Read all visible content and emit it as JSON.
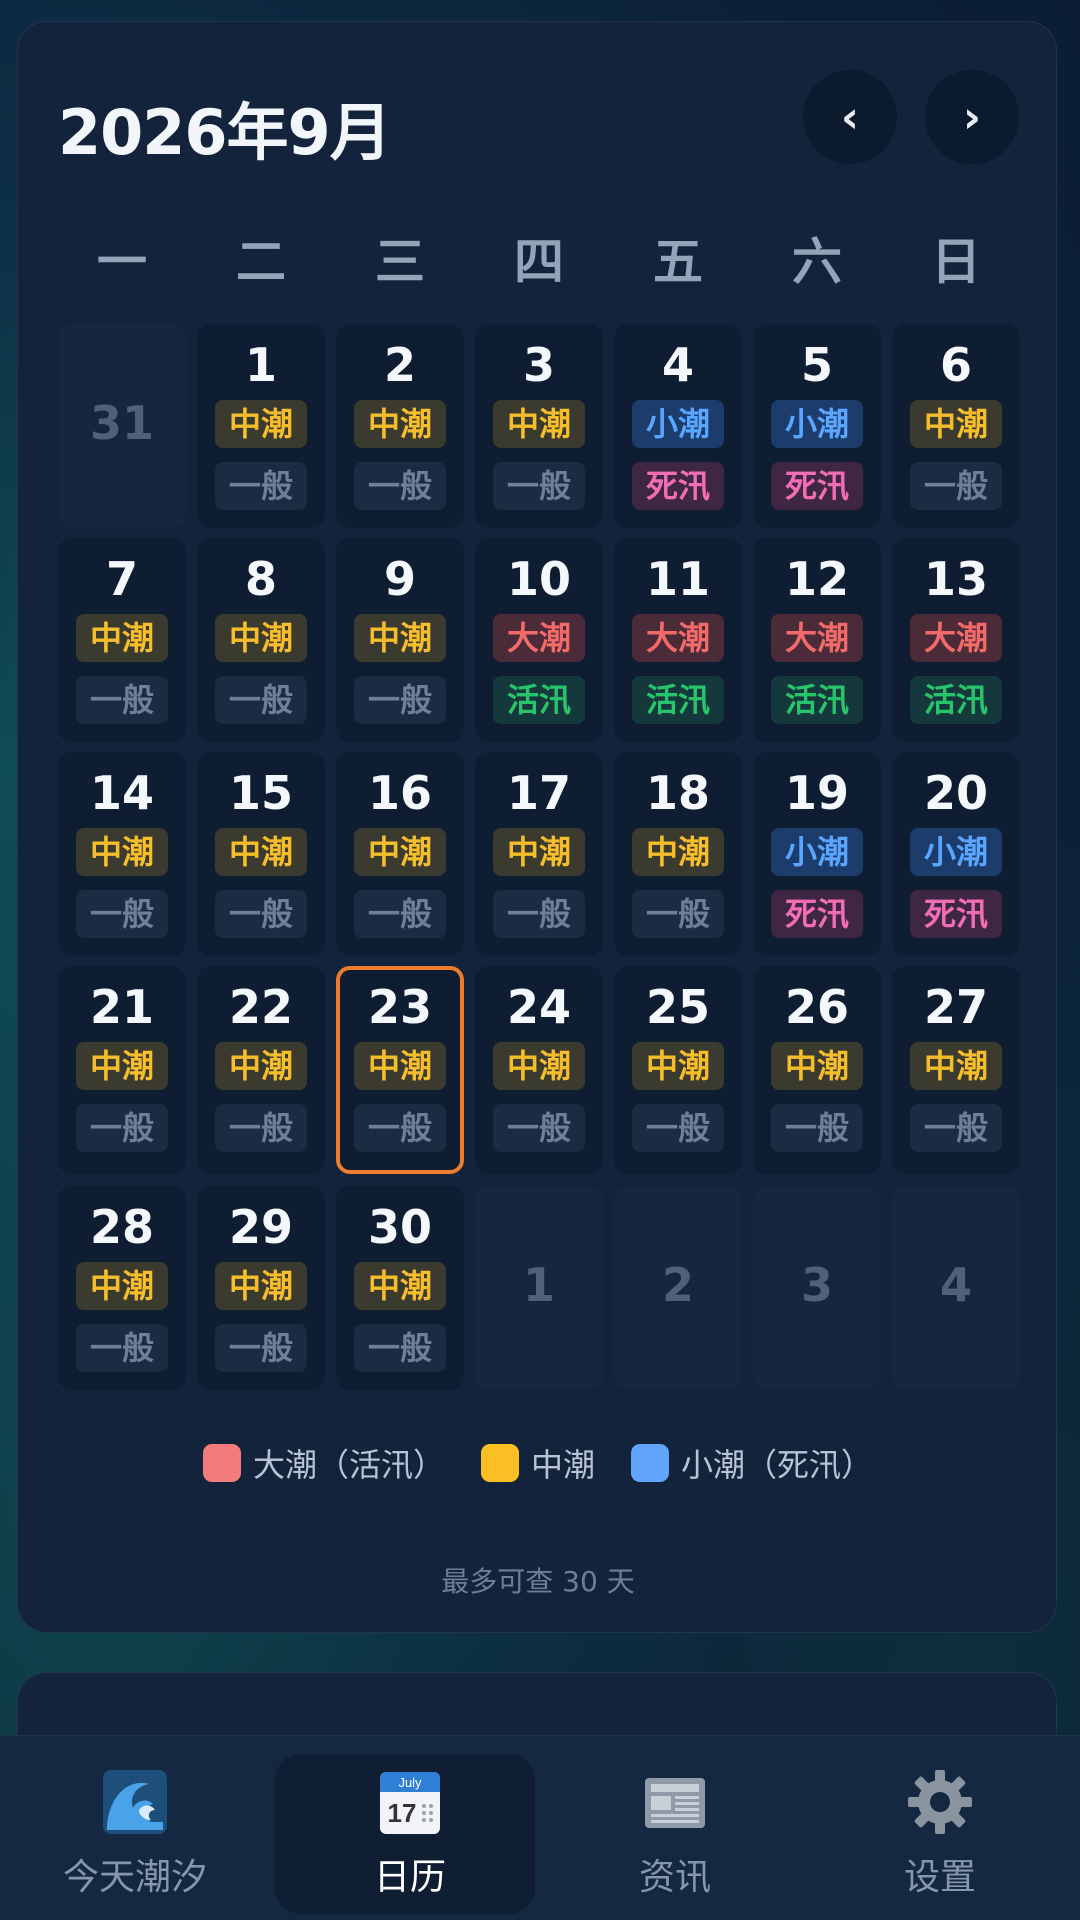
{
  "header": {
    "title": "2026年9月",
    "prev_icon": "‹",
    "next_icon": "›"
  },
  "weekdays": [
    "一",
    "二",
    "三",
    "四",
    "五",
    "六",
    "日"
  ],
  "weeks": [
    [
      {
        "day": "31",
        "outside": true
      },
      {
        "day": "1",
        "tide": "中潮",
        "tide_type": "mid",
        "fish": "一般",
        "fish_type": "normal"
      },
      {
        "day": "2",
        "tide": "中潮",
        "tide_type": "mid",
        "fish": "一般",
        "fish_type": "normal"
      },
      {
        "day": "3",
        "tide": "中潮",
        "tide_type": "mid",
        "fish": "一般",
        "fish_type": "normal"
      },
      {
        "day": "4",
        "tide": "小潮",
        "tide_type": "small",
        "fish": "死汛",
        "fish_type": "dead"
      },
      {
        "day": "5",
        "tide": "小潮",
        "tide_type": "small",
        "fish": "死汛",
        "fish_type": "dead"
      },
      {
        "day": "6",
        "tide": "中潮",
        "tide_type": "mid",
        "fish": "一般",
        "fish_type": "normal"
      }
    ],
    [
      {
        "day": "7",
        "tide": "中潮",
        "tide_type": "mid",
        "fish": "一般",
        "fish_type": "normal"
      },
      {
        "day": "8",
        "tide": "中潮",
        "tide_type": "mid",
        "fish": "一般",
        "fish_type": "normal"
      },
      {
        "day": "9",
        "tide": "中潮",
        "tide_type": "mid",
        "fish": "一般",
        "fish_type": "normal"
      },
      {
        "day": "10",
        "tide": "大潮",
        "tide_type": "big",
        "fish": "活汛",
        "fish_type": "live"
      },
      {
        "day": "11",
        "tide": "大潮",
        "tide_type": "big",
        "fish": "活汛",
        "fish_type": "live"
      },
      {
        "day": "12",
        "tide": "大潮",
        "tide_type": "big",
        "fish": "活汛",
        "fish_type": "live"
      },
      {
        "day": "13",
        "tide": "大潮",
        "tide_type": "big",
        "fish": "活汛",
        "fish_type": "live"
      }
    ],
    [
      {
        "day": "14",
        "tide": "中潮",
        "tide_type": "mid",
        "fish": "一般",
        "fish_type": "normal"
      },
      {
        "day": "15",
        "tide": "中潮",
        "tide_type": "mid",
        "fish": "一般",
        "fish_type": "normal"
      },
      {
        "day": "16",
        "tide": "中潮",
        "tide_type": "mid",
        "fish": "一般",
        "fish_type": "normal"
      },
      {
        "day": "17",
        "tide": "中潮",
        "tide_type": "mid",
        "fish": "一般",
        "fish_type": "normal"
      },
      {
        "day": "18",
        "tide": "中潮",
        "tide_type": "mid",
        "fish": "一般",
        "fish_type": "normal"
      },
      {
        "day": "19",
        "tide": "小潮",
        "tide_type": "small",
        "fish": "死汛",
        "fish_type": "dead"
      },
      {
        "day": "20",
        "tide": "小潮",
        "tide_type": "small",
        "fish": "死汛",
        "fish_type": "dead"
      }
    ],
    [
      {
        "day": "21",
        "tide": "中潮",
        "tide_type": "mid",
        "fish": "一般",
        "fish_type": "normal"
      },
      {
        "day": "22",
        "tide": "中潮",
        "tide_type": "mid",
        "fish": "一般",
        "fish_type": "normal"
      },
      {
        "day": "23",
        "tide": "中潮",
        "tide_type": "mid",
        "fish": "一般",
        "fish_type": "normal",
        "today": true
      },
      {
        "day": "24",
        "tide": "中潮",
        "tide_type": "mid",
        "fish": "一般",
        "fish_type": "normal"
      },
      {
        "day": "25",
        "tide": "中潮",
        "tide_type": "mid",
        "fish": "一般",
        "fish_type": "normal"
      },
      {
        "day": "26",
        "tide": "中潮",
        "tide_type": "mid",
        "fish": "一般",
        "fish_type": "normal"
      },
      {
        "day": "27",
        "tide": "中潮",
        "tide_type": "mid",
        "fish": "一般",
        "fish_type": "normal"
      }
    ],
    [
      {
        "day": "28",
        "tide": "中潮",
        "tide_type": "mid",
        "fish": "一般",
        "fish_type": "normal"
      },
      {
        "day": "29",
        "tide": "中潮",
        "tide_type": "mid",
        "fish": "一般",
        "fish_type": "normal"
      },
      {
        "day": "30",
        "tide": "中潮",
        "tide_type": "mid",
        "fish": "一般",
        "fish_type": "normal"
      },
      {
        "day": "1",
        "outside": true
      },
      {
        "day": "2",
        "outside": true
      },
      {
        "day": "3",
        "outside": true
      },
      {
        "day": "4",
        "outside": true
      }
    ]
  ],
  "legend": [
    {
      "label": "大潮（活汛）",
      "color": "#f47b7b"
    },
    {
      "label": "中潮",
      "color": "#fbbf24"
    },
    {
      "label": "小潮（死汛）",
      "color": "#60a5fa"
    }
  ],
  "note": "最多可查 30 天",
  "tabs": [
    {
      "label": "今天潮汐",
      "icon": "wave-icon",
      "active": false
    },
    {
      "label": "日历",
      "icon": "calendar-icon",
      "active": true,
      "calendar_month": "July",
      "calendar_day": "17"
    },
    {
      "label": "资讯",
      "icon": "newspaper-icon",
      "active": false
    },
    {
      "label": "设置",
      "icon": "gear-icon",
      "active": false
    }
  ],
  "colors": {
    "today_border": "#f07c2e",
    "card_bg": "#12233b",
    "accent_text": "#ffffff"
  }
}
